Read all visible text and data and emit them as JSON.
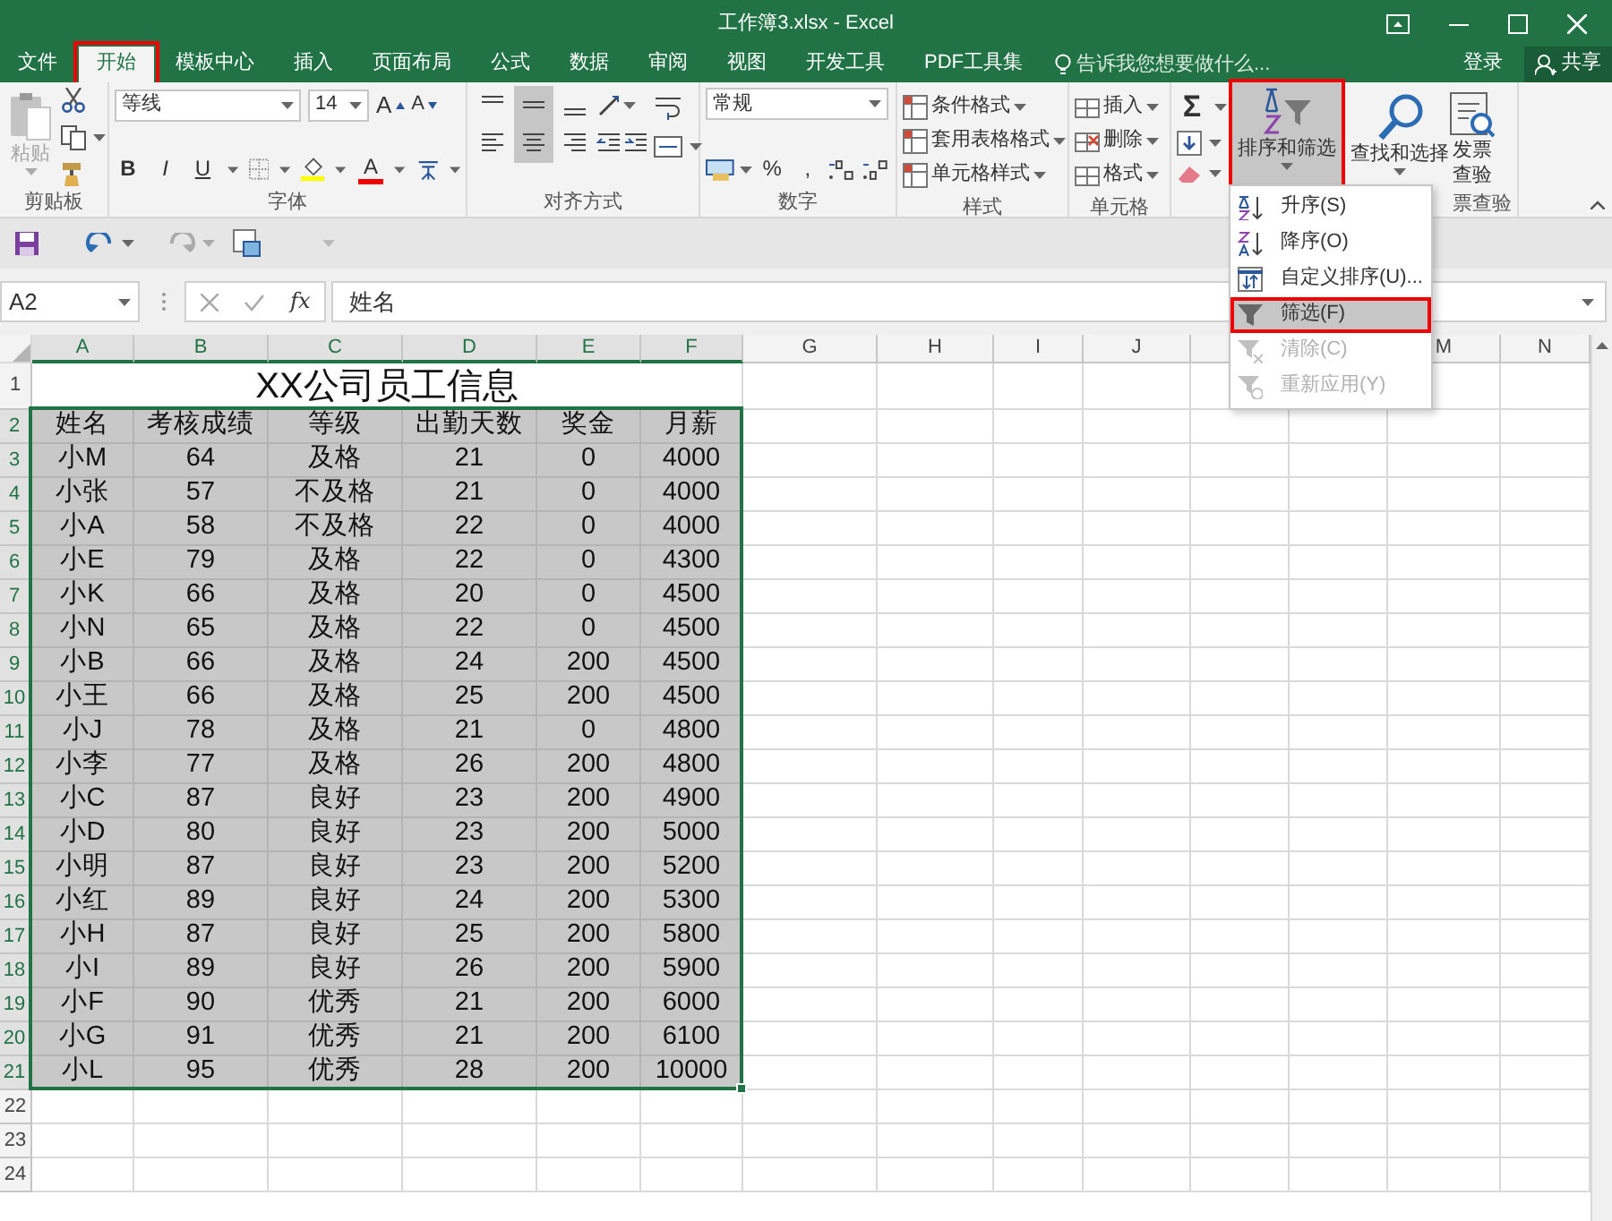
{
  "window": {
    "title": "工作簿3.xlsx - Excel"
  },
  "tabs": [
    {
      "label": "文件",
      "selected": false,
      "highlighted": false
    },
    {
      "label": "开始",
      "selected": true,
      "highlighted": true
    },
    {
      "label": "模板中心",
      "selected": false,
      "highlighted": false
    },
    {
      "label": "插入",
      "selected": false,
      "highlighted": false
    },
    {
      "label": "页面布局",
      "selected": false,
      "highlighted": false
    },
    {
      "label": "公式",
      "selected": false,
      "highlighted": false
    },
    {
      "label": "数据",
      "selected": false,
      "highlighted": false
    },
    {
      "label": "审阅",
      "selected": false,
      "highlighted": false
    },
    {
      "label": "视图",
      "selected": false,
      "highlighted": false
    },
    {
      "label": "开发工具",
      "selected": false,
      "highlighted": false
    },
    {
      "label": "PDF工具集",
      "selected": false,
      "highlighted": false
    }
  ],
  "tell_me": {
    "placeholder": "告诉我您想要做什么..."
  },
  "account": {
    "sign_in": "登录",
    "share": "共享"
  },
  "ribbon": {
    "clipboard": {
      "paste": {
        "label": "粘贴",
        "disabled": true
      },
      "label": "剪贴板"
    },
    "font": {
      "name": "等线",
      "size": "14",
      "grow": "A",
      "shrink": "A",
      "bold": "B",
      "italic": "I",
      "underline": "U",
      "font_color": "A",
      "label": "字体"
    },
    "alignment": {
      "vertical": [
        {
          "selected": false
        },
        {
          "selected": true
        },
        {
          "selected": false
        }
      ],
      "horizontal": [
        {
          "selected": false
        },
        {
          "selected": true
        },
        {
          "selected": false
        }
      ],
      "label": "对齐方式"
    },
    "number": {
      "format": "常规",
      "percent": "%",
      "comma": ",",
      "label": "数字"
    },
    "styles": {
      "items": [
        "条件格式",
        "套用表格格式",
        "单元格样式"
      ],
      "label": "样式"
    },
    "cells": {
      "items": [
        "插入",
        "删除",
        "格式"
      ],
      "label": "单元格"
    },
    "editing": {
      "autosum": "Σ",
      "sort_filter": {
        "label": "排序和筛选",
        "pressed": true,
        "highlighted": true
      },
      "find_select": "查找和选择"
    },
    "invoice": {
      "button": "发票查验",
      "label": "票查验"
    }
  },
  "quick_access": {
    "undo": {
      "disabled": false
    },
    "redo": {
      "disabled": true
    }
  },
  "formula_bar": {
    "name_box": "A2",
    "insert_function": "fx",
    "value": "姓名"
  },
  "sort_menu": {
    "items": [
      {
        "label": "升序(S)",
        "disabled": false,
        "hovered": false,
        "highlighted": false
      },
      {
        "label": "降序(O)",
        "disabled": false,
        "hovered": false,
        "highlighted": false
      },
      {
        "label": "自定义排序(U)...",
        "disabled": false,
        "hovered": false,
        "highlighted": false
      },
      {
        "label": "筛选(F)",
        "disabled": false,
        "hovered": true,
        "highlighted": true
      },
      {
        "label": "清除(C)",
        "disabled": true,
        "hovered": false,
        "highlighted": false
      },
      {
        "label": "重新应用(Y)",
        "disabled": true,
        "hovered": false,
        "highlighted": false
      }
    ]
  },
  "sheet": {
    "columns": [
      {
        "label": "A",
        "selected": true
      },
      {
        "label": "B",
        "selected": true
      },
      {
        "label": "C",
        "selected": true
      },
      {
        "label": "D",
        "selected": true
      },
      {
        "label": "E",
        "selected": true
      },
      {
        "label": "F",
        "selected": true
      },
      {
        "label": "G",
        "selected": false
      },
      {
        "label": "H",
        "selected": false
      },
      {
        "label": "I",
        "selected": false
      },
      {
        "label": "J",
        "selected": false
      },
      {
        "selected": false
      },
      null,
      {
        "label": "M",
        "selected": false
      },
      {
        "label": "N",
        "selected": false
      }
    ],
    "title_row": {
      "number": "1",
      "selected": false,
      "title": "XX公司员工信息"
    },
    "rows": [
      {
        "number": "2",
        "selected": true,
        "cells": [
          "姓名",
          "考核成绩",
          "等级",
          "出勤天数",
          "奖金",
          "月薪"
        ]
      },
      {
        "number": "3",
        "selected": true,
        "cells": [
          "小M",
          "64",
          "及格",
          "21",
          "0",
          "4000"
        ]
      },
      {
        "number": "4",
        "selected": true,
        "cells": [
          "小张",
          "57",
          "不及格",
          "21",
          "0",
          "4000"
        ]
      },
      {
        "number": "5",
        "selected": true,
        "cells": [
          "小A",
          "58",
          "不及格",
          "22",
          "0",
          "4000"
        ]
      },
      {
        "number": "6",
        "selected": true,
        "cells": [
          "小E",
          "79",
          "及格",
          "22",
          "0",
          "4300"
        ]
      },
      {
        "number": "7",
        "selected": true,
        "cells": [
          "小K",
          "66",
          "及格",
          "20",
          "0",
          "4500"
        ]
      },
      {
        "number": "8",
        "selected": true,
        "cells": [
          "小N",
          "65",
          "及格",
          "22",
          "0",
          "4500"
        ]
      },
      {
        "number": "9",
        "selected": true,
        "cells": [
          "小B",
          "66",
          "及格",
          "24",
          "200",
          "4500"
        ]
      },
      {
        "number": "10",
        "selected": true,
        "cells": [
          "小王",
          "66",
          "及格",
          "25",
          "200",
          "4500"
        ]
      },
      {
        "number": "11",
        "selected": true,
        "cells": [
          "小J",
          "78",
          "及格",
          "21",
          "0",
          "4800"
        ]
      },
      {
        "number": "12",
        "selected": true,
        "cells": [
          "小李",
          "77",
          "及格",
          "26",
          "200",
          "4800"
        ]
      },
      {
        "number": "13",
        "selected": true,
        "cells": [
          "小C",
          "87",
          "良好",
          "23",
          "200",
          "4900"
        ]
      },
      {
        "number": "14",
        "selected": true,
        "cells": [
          "小D",
          "80",
          "良好",
          "23",
          "200",
          "5000"
        ]
      },
      {
        "number": "15",
        "selected": true,
        "cells": [
          "小明",
          "87",
          "良好",
          "23",
          "200",
          "5200"
        ]
      },
      {
        "number": "16",
        "selected": true,
        "cells": [
          "小红",
          "89",
          "良好",
          "24",
          "200",
          "5300"
        ]
      },
      {
        "number": "17",
        "selected": true,
        "cells": [
          "小H",
          "87",
          "良好",
          "25",
          "200",
          "5800"
        ]
      },
      {
        "number": "18",
        "selected": true,
        "cells": [
          "小I",
          "89",
          "良好",
          "26",
          "200",
          "5900"
        ]
      },
      {
        "number": "19",
        "selected": true,
        "cells": [
          "小F",
          "90",
          "优秀",
          "21",
          "200",
          "6000"
        ]
      },
      {
        "number": "20",
        "selected": true,
        "cells": [
          "小G",
          "91",
          "优秀",
          "21",
          "200",
          "6100"
        ]
      },
      {
        "number": "21",
        "selected": true,
        "cells": [
          "小L",
          "95",
          "优秀",
          "28",
          "200",
          "10000"
        ]
      },
      {
        "number": "22",
        "selected": false
      },
      {
        "number": "23",
        "selected": false
      },
      {
        "number": "24",
        "selected": false
      }
    ]
  }
}
